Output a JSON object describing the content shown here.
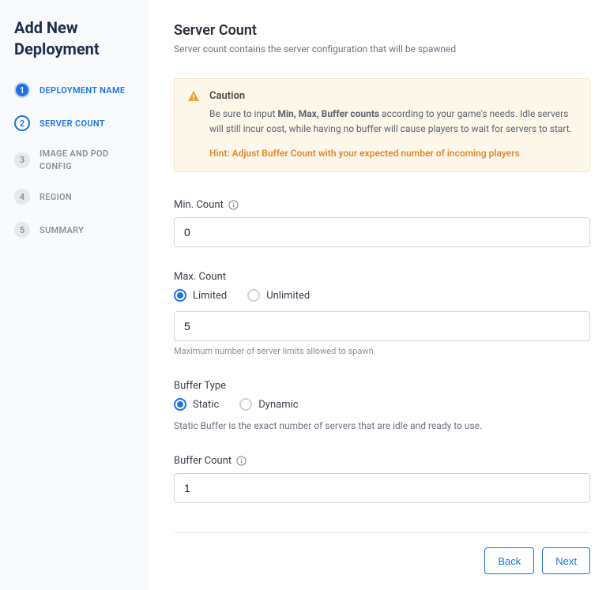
{
  "sidebar": {
    "title": "Add New Deployment",
    "steps": [
      {
        "num": "1",
        "label": "DEPLOYMENT NAME",
        "state": "done"
      },
      {
        "num": "2",
        "label": "SERVER COUNT",
        "state": "active"
      },
      {
        "num": "3",
        "label": "IMAGE AND POD CONFIG",
        "state": "pending"
      },
      {
        "num": "4",
        "label": "REGION",
        "state": "pending"
      },
      {
        "num": "5",
        "label": "SUMMARY",
        "state": "pending"
      }
    ]
  },
  "main": {
    "title": "Server Count",
    "subtitle": "Server count contains the server configuration that will be spawned",
    "caution": {
      "title": "Caution",
      "body_a": "Be sure to input ",
      "body_b": "Min, Max, Buffer counts",
      "body_c": " according to your game's needs. Idle servers will still incur cost, while having no buffer will cause players to wait for servers to start.",
      "hint": "Hint: Adjust Buffer Count with your expected number of incoming players"
    },
    "minCount": {
      "label": "Min. Count",
      "value": "0"
    },
    "maxCount": {
      "label": "Max. Count",
      "options": {
        "limited": "Limited",
        "unlimited": "Unlimited"
      },
      "selected": "limited",
      "value": "5",
      "helper": "Maximum number of server limits allowed to spawn"
    },
    "bufferType": {
      "label": "Buffer Type",
      "options": {
        "static": "Static",
        "dynamic": "Dynamic"
      },
      "selected": "static",
      "desc": "Static Buffer is the exact number of servers that are idle and ready to use."
    },
    "bufferCount": {
      "label": "Buffer Count",
      "value": "1"
    },
    "footer": {
      "back": "Back",
      "next": "Next"
    }
  }
}
